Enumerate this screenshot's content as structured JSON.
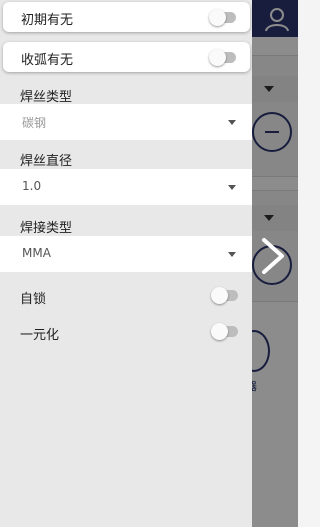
{
  "colors": {
    "header": "#2c3670",
    "drawer_bg": "#e8e8e8",
    "toggle_off": "#bdbdbd"
  },
  "background": {
    "user_icon": "user-icon",
    "bottom_label": "器"
  },
  "drawer": {
    "toggles_top": [
      {
        "label": "初期有无",
        "on": false
      },
      {
        "label": "收弧有无",
        "on": false
      }
    ],
    "wire_type": {
      "label": "焊丝类型",
      "value": "碳钢"
    },
    "wire_diameter": {
      "label": "焊丝直径",
      "value": "1.0"
    },
    "weld_type": {
      "label": "焊接类型",
      "value": "MMA"
    },
    "toggles_bottom": [
      {
        "label": "自锁",
        "on": false
      },
      {
        "label": "一元化",
        "on": false
      }
    ]
  }
}
